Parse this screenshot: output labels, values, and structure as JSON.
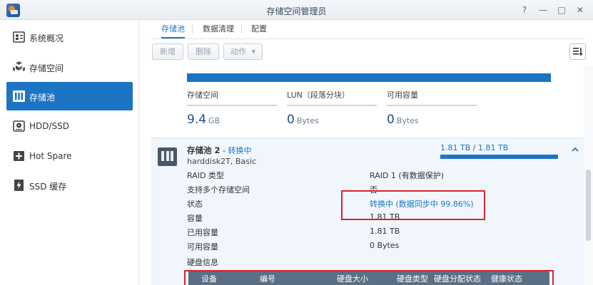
{
  "window": {
    "title": "存储空间管理员",
    "controls": {
      "help": "?",
      "minimize": "—",
      "maximize": "□",
      "close": "✕"
    }
  },
  "sidebar": {
    "items": [
      {
        "label": "系统概况",
        "icon": "overview-icon",
        "active": false
      },
      {
        "label": "存储空间",
        "icon": "volume-icon",
        "active": false
      },
      {
        "label": "存储池",
        "icon": "storage-pool-icon",
        "active": true
      },
      {
        "label": "HDD/SSD",
        "icon": "hdd-icon",
        "active": false
      },
      {
        "label": "Hot Spare",
        "icon": "hot-spare-icon",
        "active": false
      },
      {
        "label": "SSD 缓存",
        "icon": "ssd-cache-icon",
        "active": false
      }
    ]
  },
  "tabs": [
    {
      "label": "存储池",
      "active": true
    },
    {
      "label": "数据清理",
      "active": false
    },
    {
      "label": "配置",
      "active": false
    }
  ],
  "toolbar": {
    "add_label": "新增",
    "delete_label": "删除",
    "action_label": "动作",
    "action_caret": "▾"
  },
  "pool1": {
    "stats": [
      {
        "label": "存储空间",
        "value": "9.4",
        "unit": "GB"
      },
      {
        "label": "LUN（段落分块）",
        "value": "0",
        "unit": "Bytes"
      },
      {
        "label": "可用容量",
        "value": "0",
        "unit": "Bytes"
      }
    ]
  },
  "pool2": {
    "name": "存储池 2",
    "separator": " - ",
    "status_short": "转换中",
    "subtitle": "harddisk2T, Basic",
    "capacity_text": "1.81 TB / 1.81 TB",
    "capacity_fraction": 1.0,
    "details": [
      {
        "label": "RAID 类型",
        "value": "RAID 1 (有数据保护)",
        "link": false
      },
      {
        "label": "支持多个存储空间",
        "value": "否",
        "link": false
      },
      {
        "label": "状态",
        "value": "转换中 (数据同步中 99.86%)",
        "link": true
      },
      {
        "label": "容量",
        "value": "1.81 TB",
        "link": false
      },
      {
        "label": "已用容量",
        "value": "1.81 TB",
        "link": false
      },
      {
        "label": "可用容量",
        "value": "0 Bytes",
        "link": false
      }
    ],
    "disk_info_title": "硬盘信息",
    "disk_columns": [
      "设备",
      "编号",
      "硬盘大小",
      "硬盘类型",
      "硬盘分配状态",
      "健康状态"
    ]
  },
  "colors": {
    "accent": "#1b74c4",
    "annotation": "#d9232d",
    "table_header": "#5a6f85"
  }
}
